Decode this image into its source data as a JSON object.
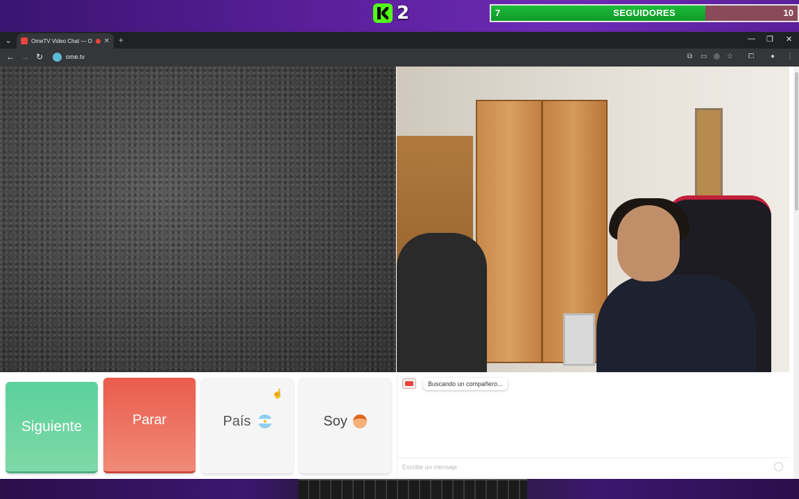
{
  "stream_overlay": {
    "kick_count": "2",
    "goal": {
      "start": "7",
      "label": "SEGUIDORES",
      "end": "10",
      "progress": 0.7
    }
  },
  "browser": {
    "tab_title": "OmeTV Video Chat — Ome",
    "new_tab_symbol": "+",
    "url": "ome.tv"
  },
  "controls": {
    "next_label": "Siguiente",
    "stop_label": "Parar",
    "country_label": "País",
    "gender_label": "Soy"
  },
  "chat": {
    "status_message": "Buscando un compañero...",
    "input_placeholder": "Escribe un mensaje"
  },
  "colors": {
    "next_button": "#6fd4a0",
    "stop_button": "#ec6c5c",
    "goal_fill": "#1aae36",
    "overlay_purple": "#5a1f9a"
  }
}
